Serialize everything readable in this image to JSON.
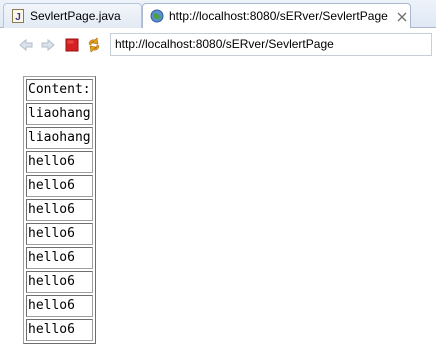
{
  "tabs": [
    {
      "label": "SevlertPage.java",
      "icon": "java-file-icon",
      "active": false
    },
    {
      "label": "http://localhost:8080/sERver/SevlertPage",
      "icon": "globe-icon",
      "active": true,
      "close_icon": "close-icon"
    }
  ],
  "toolbar": {
    "buttons": [
      "back-arrow-icon",
      "forward-arrow-icon",
      "stop-icon",
      "refresh-icon"
    ],
    "url": "http://localhost:8080/sERver/SevlertPage"
  },
  "table": {
    "rows": [
      "Content:",
      "liaohang",
      "liaohang",
      "hello6",
      "hello6",
      "hello6",
      "hello6",
      "hello6",
      "hello6",
      "hello6",
      "hello6"
    ]
  },
  "colors": {
    "stop_red": "#d42020",
    "refresh_orange": "#e8a020",
    "tab_border": "#a9b8cf"
  }
}
